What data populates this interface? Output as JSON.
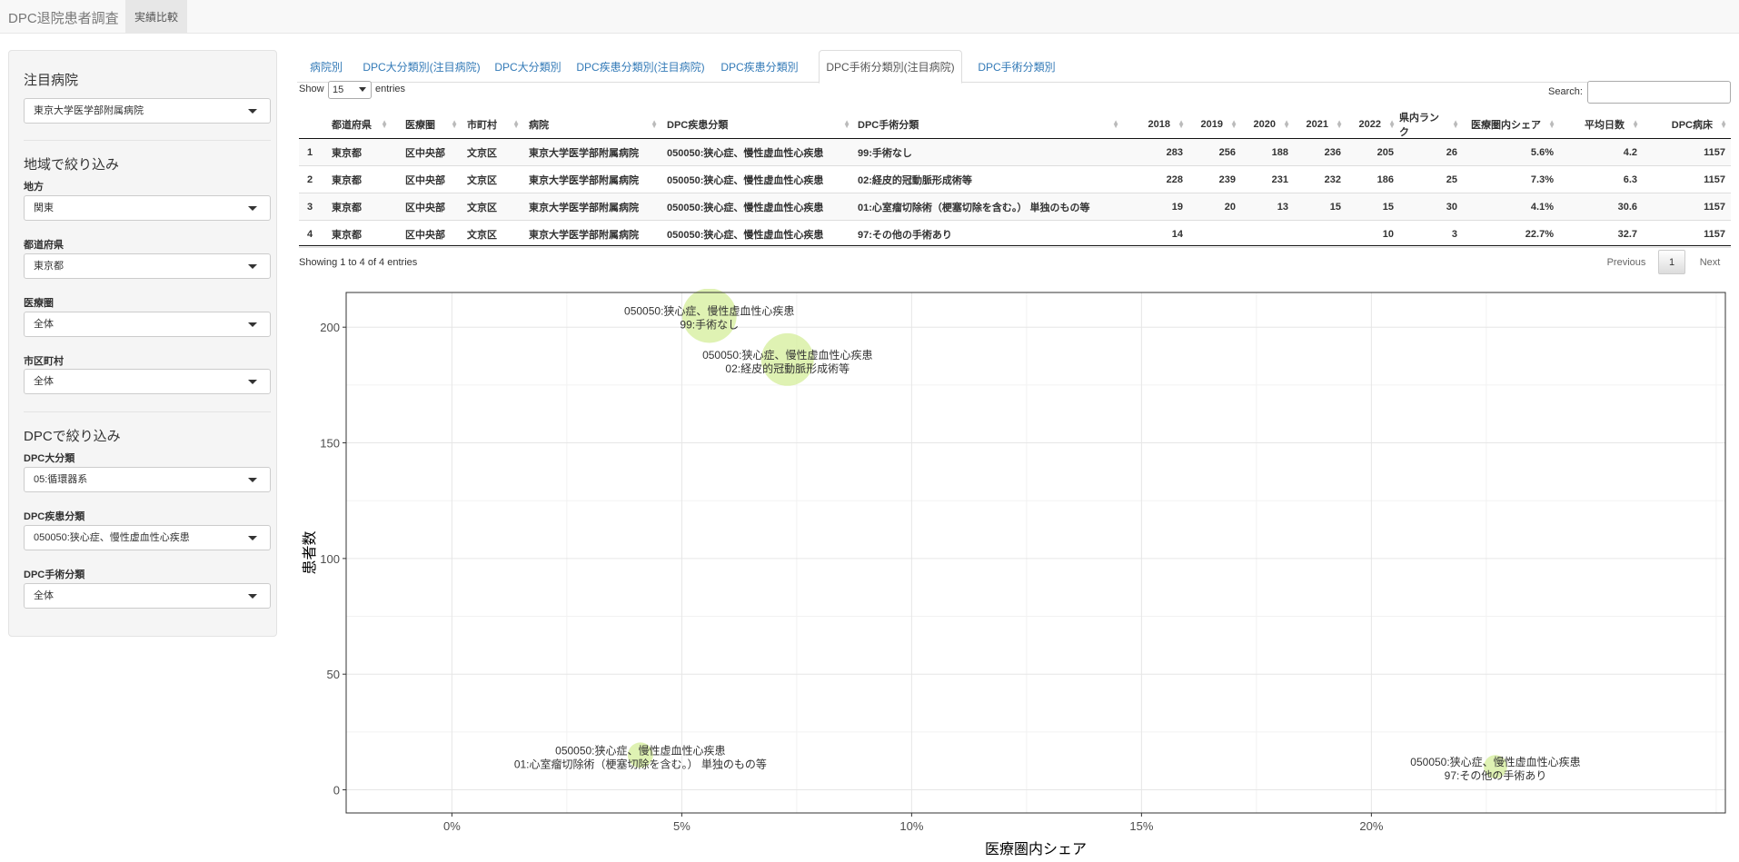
{
  "navbar": {
    "brand": "DPC退院患者調査",
    "tab": "実績比較"
  },
  "sidebar": {
    "hospital_heading": "注目病院",
    "hospital_value": "東京大学医学部附属病院",
    "region_heading": "地域で絞り込み",
    "region_label": "地方",
    "region_value": "関東",
    "pref_label": "都道府県",
    "pref_value": "東京都",
    "area_label": "医療圏",
    "area_value": "全体",
    "city_label": "市区町村",
    "city_value": "全体",
    "dpc_heading": "DPCで絞り込み",
    "major_label": "DPC大分類",
    "major_value": "05:循環器系",
    "disease_label": "DPC疾患分類",
    "disease_value": "050050:狭心症、慢性虚血性心疾患",
    "surgery_label": "DPC手術分類",
    "surgery_value": "全体"
  },
  "tabs": [
    {
      "label": "病院別",
      "active": false
    },
    {
      "label": "DPC大分類別(注目病院)",
      "active": false
    },
    {
      "label": "DPC大分類別",
      "active": false
    },
    {
      "label": "DPC疾患分類別(注目病院)",
      "active": false
    },
    {
      "label": "DPC疾患分類別",
      "active": false
    },
    {
      "label": "DPC手術分類別(注目病院)",
      "active": true
    },
    {
      "label": "DPC手術分類別",
      "active": false
    }
  ],
  "table_controls": {
    "show_label": "Show",
    "length_value": "15",
    "entries_label": "entries",
    "search_label": "Search:",
    "info": "Showing 1 to 4 of 4 entries",
    "previous": "Previous",
    "page": "1",
    "next": "Next"
  },
  "table": {
    "headers": [
      "",
      "都道府県",
      "医療圏",
      "市町村",
      "病院",
      "DPC疾患分類",
      "DPC手術分類",
      "2018",
      "2019",
      "2020",
      "2021",
      "2022",
      "県内ランク",
      "医療圏内シェア",
      "平均日数",
      "DPC病床"
    ],
    "rows": [
      [
        "1",
        "東京都",
        "区中央部",
        "文京区",
        "東京大学医学部附属病院",
        "050050:狭心症、慢性虚血性心疾患",
        "99:手術なし",
        "283",
        "256",
        "188",
        "236",
        "205",
        "26",
        "5.6%",
        "4.2",
        "1157"
      ],
      [
        "2",
        "東京都",
        "区中央部",
        "文京区",
        "東京大学医学部附属病院",
        "050050:狭心症、慢性虚血性心疾患",
        "02:経皮的冠動脈形成術等",
        "228",
        "239",
        "231",
        "232",
        "186",
        "25",
        "7.3%",
        "6.3",
        "1157"
      ],
      [
        "3",
        "東京都",
        "区中央部",
        "文京区",
        "東京大学医学部附属病院",
        "050050:狭心症、慢性虚血性心疾患",
        "01:心室瘤切除術（梗塞切除を含む。） 単独のもの等",
        "19",
        "20",
        "13",
        "15",
        "15",
        "30",
        "4.1%",
        "30.6",
        "1157"
      ],
      [
        "4",
        "東京都",
        "区中央部",
        "文京区",
        "東京大学医学部附属病院",
        "050050:狭心症、慢性虚血性心疾患",
        "97:その他の手術あり",
        "14",
        "",
        "",
        "",
        "10",
        "3",
        "22.7%",
        "32.7",
        "1157"
      ]
    ]
  },
  "chart_data": {
    "type": "scatter",
    "xlabel": "医療圏内シェア",
    "ylabel": "患者数",
    "xlim": [
      -2.3,
      27.7
    ],
    "ylim": [
      -10,
      215
    ],
    "x_ticks": [
      0,
      5,
      10,
      15,
      20
    ],
    "x_tick_labels": [
      "0%",
      "5%",
      "10%",
      "15%",
      "20%"
    ],
    "y_ticks": [
      0,
      50,
      100,
      150,
      200
    ],
    "y_tick_labels": [
      "0",
      "50",
      "100",
      "150",
      "200"
    ],
    "grid": true,
    "bubble_color": "#d4ee9a",
    "points": [
      {
        "x": 5.6,
        "y": 205,
        "label1": "050050:狭心症、慢性虚血性心疾患",
        "label2": "99:手術なし"
      },
      {
        "x": 7.3,
        "y": 186,
        "label1": "050050:狭心症、慢性虚血性心疾患",
        "label2": "02:経皮的冠動脈形成術等"
      },
      {
        "x": 4.1,
        "y": 15,
        "label1": "050050:狭心症、慢性虚血性心疾患",
        "label2": "01:心室瘤切除術（梗塞切除を含む。） 単独のもの等"
      },
      {
        "x": 22.7,
        "y": 10,
        "label1": "050050:狭心症、慢性虚血性心疾患",
        "label2": "97:その他の手術あり"
      }
    ]
  }
}
